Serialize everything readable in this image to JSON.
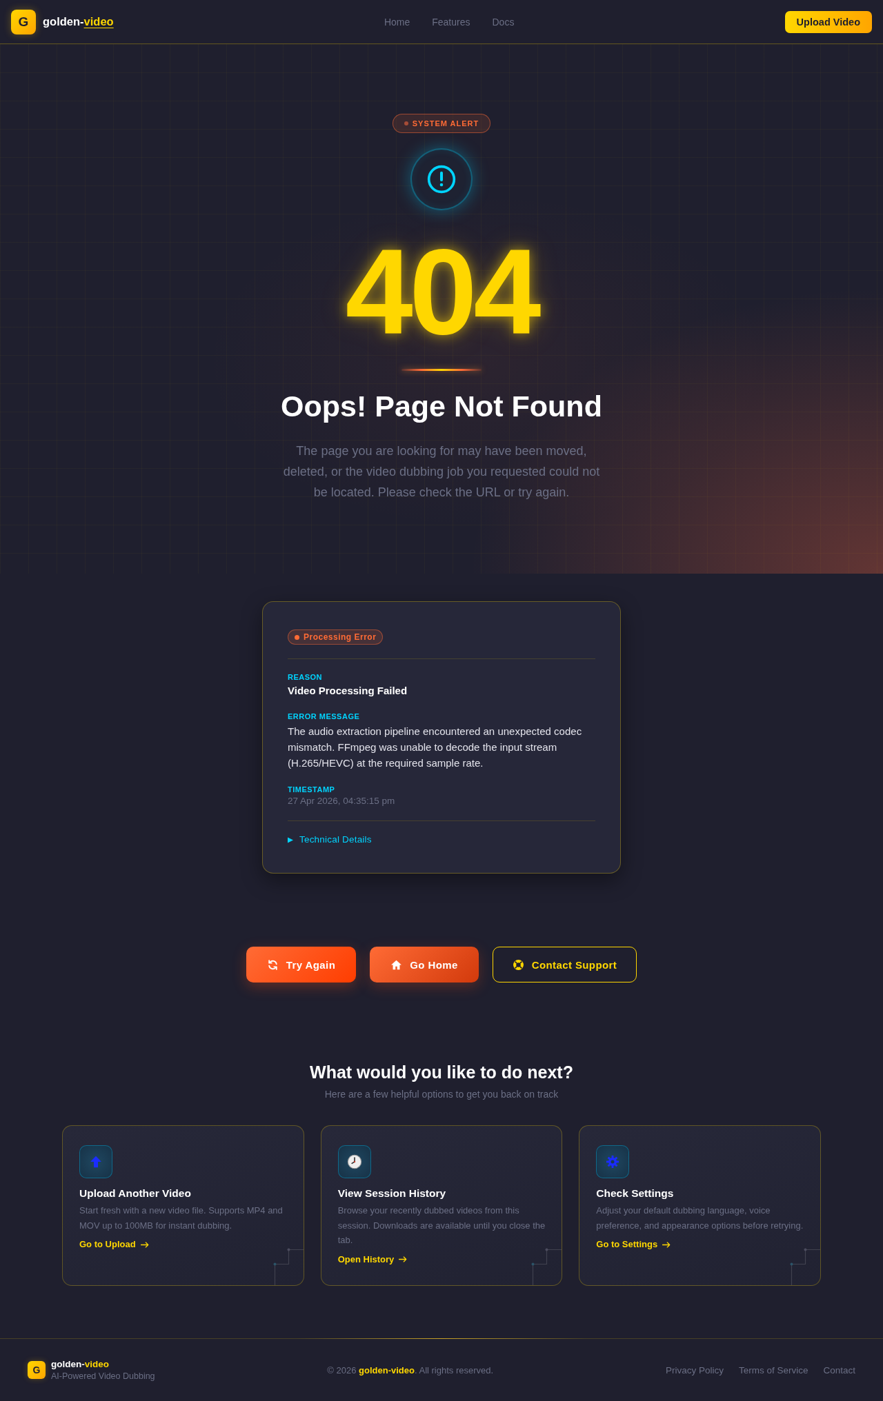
{
  "header": {
    "logo_letter": "G",
    "brand": {
      "prefix": "golden-",
      "highlight": "video"
    },
    "nav": [
      {
        "label": "Home"
      },
      {
        "label": "Features"
      },
      {
        "label": "Docs"
      }
    ],
    "upload_button": {
      "label": "Upload Video"
    }
  },
  "hero": {
    "badge": "SYSTEM ALERT",
    "code": "404",
    "title": "Oops! Page Not Found",
    "description": "The page you are looking for may have been moved, deleted, or the video dubbing job you requested could not be located. Please check the URL or try again."
  },
  "error_card": {
    "status": "Processing Error",
    "fields": [
      {
        "kind": "title",
        "label": "REASON",
        "value": "Video Processing Failed"
      },
      {
        "kind": "body",
        "label": "ERROR MESSAGE",
        "value": "The audio extraction pipeline encountered an unexpected codec mismatch. FFmpeg was unable to decode the input stream (H.265/HEVC) at the required sample rate."
      },
      {
        "kind": "meta",
        "label": "TIMESTAMP",
        "value": "27 Apr 2026, 04:35:15 pm"
      }
    ],
    "details": {
      "label": "Technical Details",
      "expanded": false
    }
  },
  "actions": [
    {
      "kind": "primary",
      "label": "Try Again"
    },
    {
      "kind": "secondary",
      "label": "Go Home"
    },
    {
      "kind": "outline",
      "label": "Contact Support"
    }
  ],
  "next_steps": {
    "title": "What would you like to do next?",
    "subtitle": "Here are a few helpful options to get you back on track",
    "cards": [
      {
        "title": "Upload Another Video",
        "description": "Start fresh with a new video file. Supports MP4 and MOV up to 100MB for instant dubbing.",
        "link": "Go to Upload"
      },
      {
        "title": "View Session History",
        "description": "Browse your recently dubbed videos from this session. Downloads are available until you close the tab.",
        "link": "Open History"
      },
      {
        "title": "Check Settings",
        "description": "Adjust your default dubbing language, voice preference, and appearance options before retrying.",
        "link": "Go to Settings"
      }
    ]
  },
  "footer": {
    "logo_letter": "G",
    "brand": {
      "prefix": "golden-",
      "highlight": "video"
    },
    "tagline": "AI-Powered Video Dubbing",
    "copyright": "© 2026 **golden-video**. All rights reserved.",
    "links": [
      {
        "label": "Privacy Policy"
      },
      {
        "label": "Terms of Service"
      },
      {
        "label": "Contact"
      }
    ]
  }
}
